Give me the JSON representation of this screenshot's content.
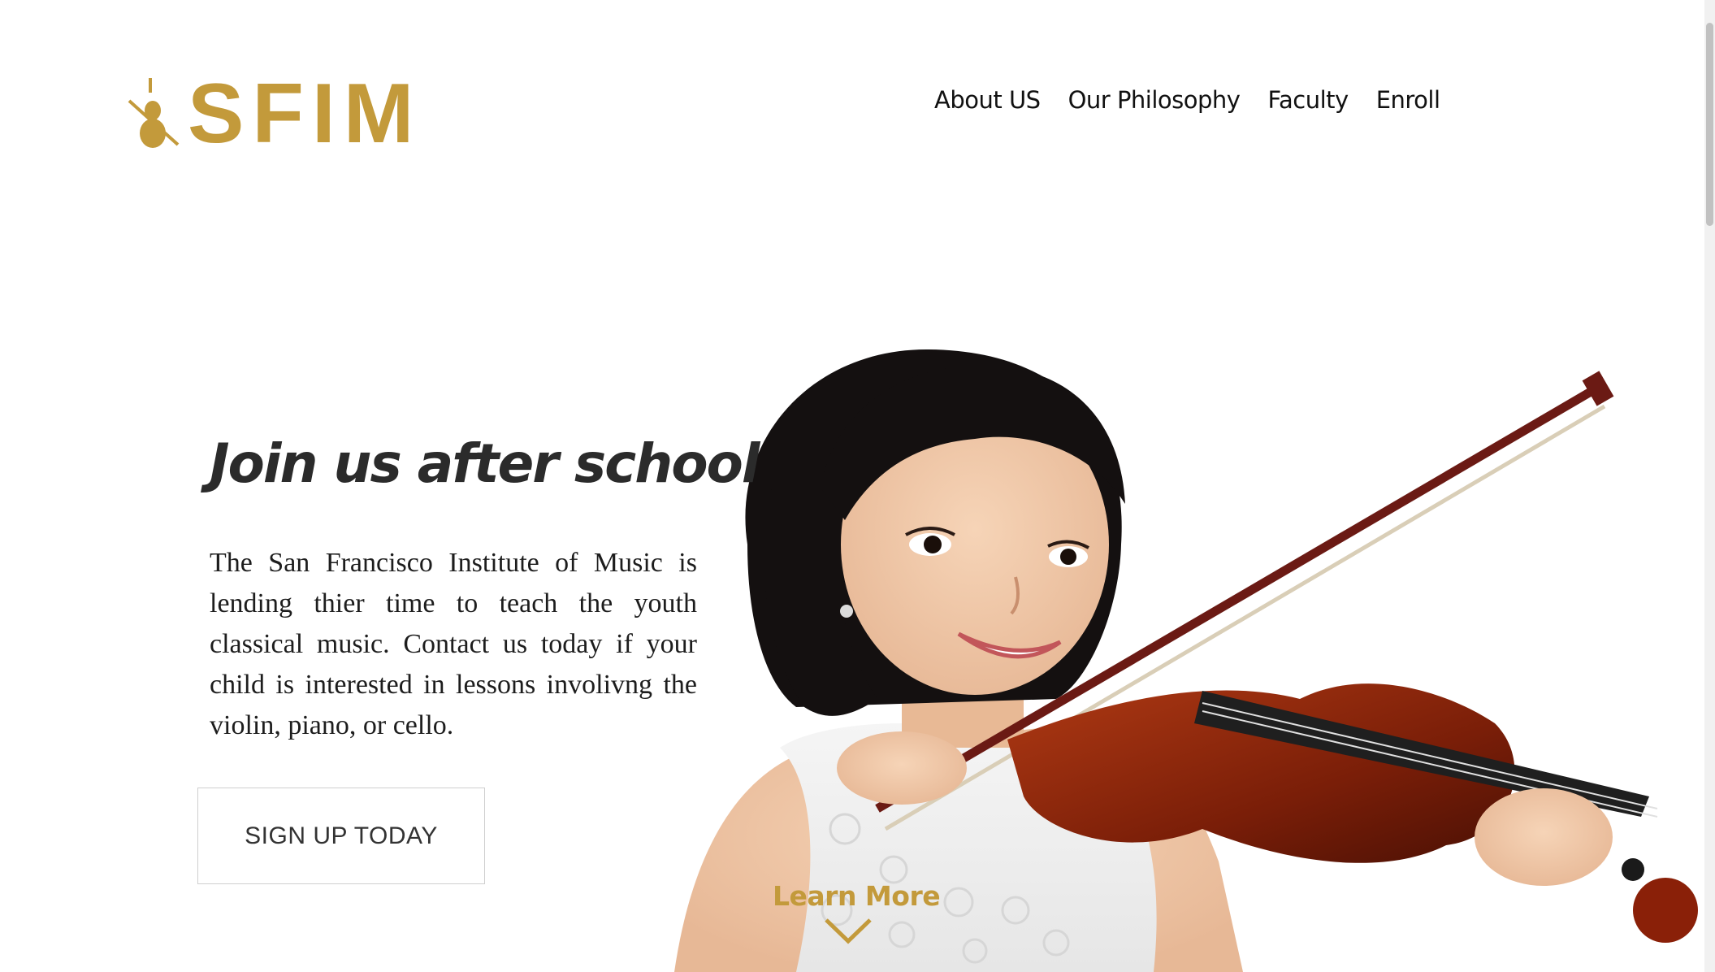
{
  "header": {
    "logo_text": "SFIM",
    "nav": [
      "About US",
      "Our Philosophy",
      "Faculty",
      "Enroll"
    ]
  },
  "hero": {
    "title": "Join us after school",
    "body": "The San Francisco Institute of Music is lending thier time to teach the youth classical music. Contact us today if your child is interested in lessons involivng the violin, piano, or cello.",
    "cta_label": "SIGN UP TODAY",
    "learn_more_label": "Learn More"
  },
  "colors": {
    "brand_gold": "#c39a3b",
    "text_dark": "#222222",
    "background": "#ffffff"
  },
  "icons": {
    "logo_mark": "violin-icon",
    "scroll_hint": "chevron-down-icon"
  }
}
